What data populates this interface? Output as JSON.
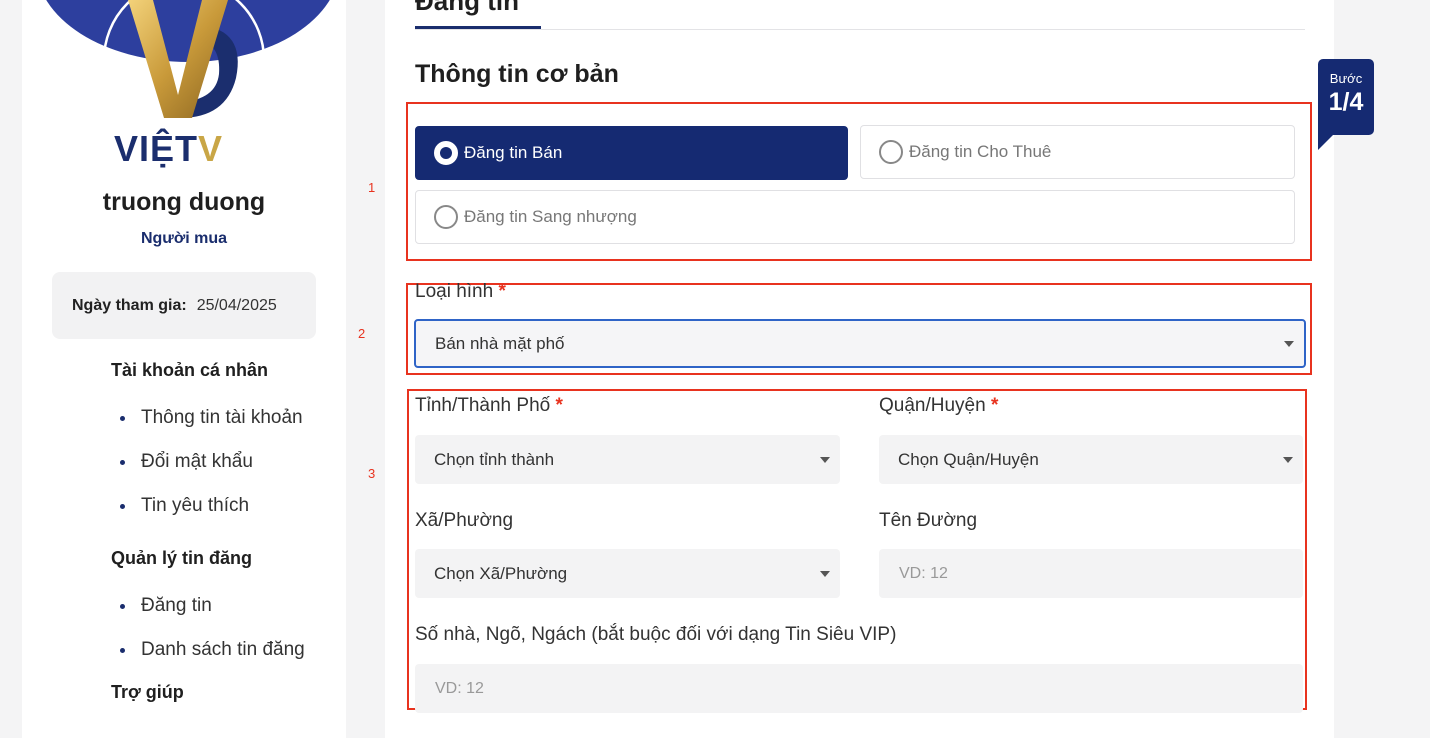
{
  "sidebar": {
    "brand": {
      "text_main": "VIỆT",
      "text_accent": "V"
    },
    "user_name": "truong duong",
    "user_role": "Người mua",
    "join_label": "Ngày tham gia:",
    "join_date": "25/04/2025",
    "sections": [
      {
        "heading": "Tài khoản cá nhân",
        "items": [
          "Thông tin tài khoản",
          "Đổi mật khẩu",
          "Tin yêu thích"
        ]
      },
      {
        "heading": "Quản lý tin đăng",
        "items": [
          "Đăng tin",
          "Danh sách tin đăng"
        ]
      },
      {
        "heading": "Trợ giúp",
        "items": []
      }
    ]
  },
  "main": {
    "tab_title": "Đăng tin",
    "section_title": "Thông tin cơ bản",
    "step_markers": [
      "1",
      "2",
      "3"
    ],
    "post_types": [
      {
        "label": "Đăng tin Bán",
        "selected": true
      },
      {
        "label": "Đăng tin Cho Thuê",
        "selected": false
      },
      {
        "label": "Đăng tin Sang nhượng",
        "selected": false
      }
    ],
    "property_type": {
      "label": "Loại hình",
      "required_mark": "*",
      "value": "Bán nhà mặt phố"
    },
    "province": {
      "label": "Tỉnh/Thành Phố",
      "required_mark": "*",
      "value": "Chọn tỉnh thành"
    },
    "district": {
      "label": "Quận/Huyện",
      "required_mark": "*",
      "value": "Chọn Quận/Huyện"
    },
    "ward": {
      "label": "Xã/Phường",
      "value": "Chọn Xã/Phường"
    },
    "street": {
      "label": "Tên Đường",
      "placeholder": "VD: 12"
    },
    "address": {
      "label": "Số nhà, Ngõ, Ngách (bắt buộc đối với dạng Tin Siêu VIP)",
      "placeholder": "VD: 12"
    }
  },
  "step_badge": {
    "label": "Bước",
    "value": "1/4"
  },
  "colors": {
    "brand_navy": "#152a72",
    "brand_gold": "#c9a646",
    "highlight_red": "#e8331f",
    "focus_blue": "#2f64c7"
  }
}
